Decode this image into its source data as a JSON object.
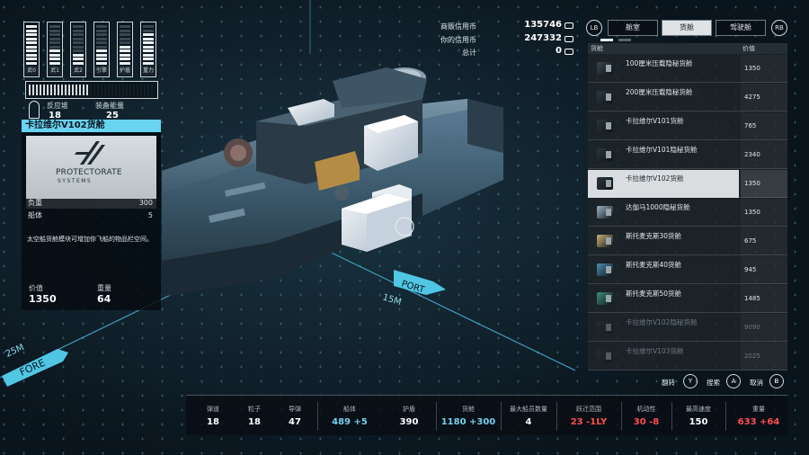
{
  "ship_systems": {
    "gauges": [
      {
        "label": "武0",
        "filled": 10,
        "total": 10
      },
      {
        "label": "武1",
        "filled": 4,
        "total": 10
      },
      {
        "label": "武2",
        "filled": 3,
        "total": 10
      },
      {
        "label": "引擎",
        "filled": 4,
        "total": 10
      },
      {
        "label": "护盾",
        "filled": 5,
        "total": 10
      },
      {
        "label": "重力",
        "filled": 8,
        "total": 10
      }
    ],
    "reactor_fill": 0.48,
    "reactor_label": "反应堆",
    "reactor_value": "18",
    "equip_label": "装备能量",
    "equip_value": "25"
  },
  "item_panel": {
    "title": "卡拉维尔V102货舱",
    "logo_line1": "PROTECTORATE",
    "logo_line2": "SYSTEMS",
    "stats": [
      {
        "key": "负重",
        "value": "300"
      },
      {
        "key": "船体",
        "value": "5"
      }
    ],
    "description": "太空船货舱模块可增加你飞船的物品栏空间。",
    "price_label": "价值",
    "price_value": "1350",
    "mass_label": "重量",
    "mass_value": "64"
  },
  "credits": [
    {
      "label": "商贩信用币",
      "value": "135746"
    },
    {
      "label": "你的信用币",
      "value": "247332"
    },
    {
      "label": "总计",
      "value": "0"
    }
  ],
  "tabs": {
    "left_button": "LB",
    "right_button": "RB",
    "items": [
      {
        "label": "舱室",
        "active": false
      },
      {
        "label": "货舱",
        "active": true
      },
      {
        "label": "驾驶舱",
        "active": false
      }
    ]
  },
  "list": {
    "header_name": "货舱",
    "header_price": "价值",
    "items": [
      {
        "name": "100厘米压载隐秘货舱",
        "price": "1350",
        "state": "normal",
        "color": "#3a4650"
      },
      {
        "name": "200厘米压载隐秘货舱",
        "price": "4275",
        "state": "normal",
        "color": "#2f3a42"
      },
      {
        "name": "卡拉维尔V101货舱",
        "price": "765",
        "state": "normal",
        "color": "#2c353c"
      },
      {
        "name": "卡拉维尔V101隐秘货舱",
        "price": "2340",
        "state": "normal",
        "color": "#2c353c"
      },
      {
        "name": "卡拉维尔V102货舱",
        "price": "1350",
        "state": "selected",
        "color": "#2c353c"
      },
      {
        "name": "达伽马1000隐秘货舱",
        "price": "1350",
        "state": "normal",
        "color": "#9fb3c4"
      },
      {
        "name": "斯托麦克斯30货舱",
        "price": "675",
        "state": "normal",
        "color": "#c9b27a"
      },
      {
        "name": "斯托麦克斯40货舱",
        "price": "945",
        "state": "normal",
        "color": "#4f8fb0"
      },
      {
        "name": "斯托麦克斯50货舱",
        "price": "1485",
        "state": "normal",
        "color": "#3f8f7a"
      },
      {
        "name": "卡拉维尔V102隐秘货舱",
        "price": "9090",
        "state": "disabled",
        "color": "#2c353c"
      },
      {
        "name": "卡拉维尔V103货舱",
        "price": "2025",
        "state": "disabled",
        "color": "#2c353c"
      }
    ]
  },
  "actions": [
    {
      "label": "翻转",
      "key": "Y"
    },
    {
      "label": "搜索",
      "key": "A"
    },
    {
      "label": "取消",
      "key": "B"
    }
  ],
  "stats_bar": [
    {
      "label": "弹道",
      "value": "18",
      "tone": "white"
    },
    {
      "label": "粒子",
      "value": "18",
      "tone": "white"
    },
    {
      "label": "导弹",
      "value": "47",
      "tone": "white"
    },
    {
      "label": "船体",
      "value": "489 +5",
      "tone": "blue"
    },
    {
      "label": "护盾",
      "value": "390",
      "tone": "white"
    },
    {
      "label": "货舱",
      "value": "1180 +300",
      "tone": "blue"
    },
    {
      "label": "最大船员数量",
      "value": "4",
      "tone": "white"
    },
    {
      "label": "跃迁范围",
      "value": "23 -1LY",
      "tone": "red"
    },
    {
      "label": "机动性",
      "value": "30 -8",
      "tone": "red"
    },
    {
      "label": "最高速度",
      "value": "150",
      "tone": "white"
    },
    {
      "label": "重量",
      "value": "633 +64",
      "tone": "red"
    }
  ],
  "scene_labels": {
    "port_dir": "PORT",
    "port_dist": "15M",
    "fore_dir": "FORE",
    "fore_dist": "25M"
  },
  "colors": {
    "accent": "#69d3f0",
    "red": "#ff4f4f",
    "blue": "#74cfee"
  }
}
